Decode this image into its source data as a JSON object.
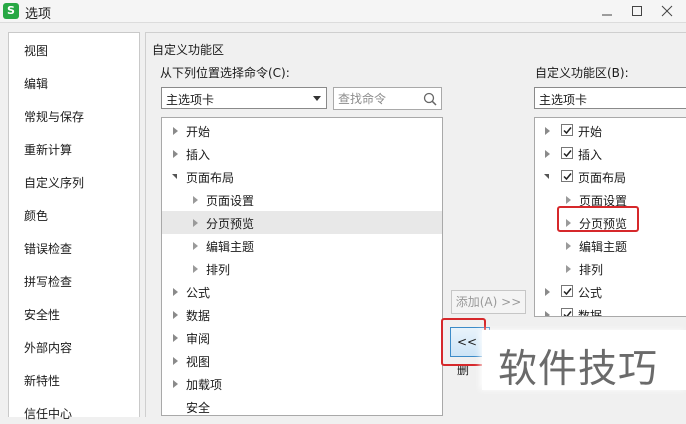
{
  "window": {
    "title": "选项",
    "app_icon_letter": "S",
    "accent_color": "#27a844"
  },
  "sidebar": {
    "items": [
      {
        "label": "视图"
      },
      {
        "label": "编辑"
      },
      {
        "label": "常规与保存"
      },
      {
        "label": "重新计算"
      },
      {
        "label": "自定义序列"
      },
      {
        "label": "颜色"
      },
      {
        "label": "错误检查"
      },
      {
        "label": "拼写检查"
      },
      {
        "label": "安全性"
      },
      {
        "label": "外部内容"
      },
      {
        "label": "新特性"
      },
      {
        "label": "信任中心"
      }
    ]
  },
  "group_title": "自定义功能区",
  "left": {
    "choose_label": "从下列位置选择命令(C):",
    "dropdown_value": "主选项卡",
    "search_placeholder": "查找命令",
    "tree": [
      {
        "label": "开始"
      },
      {
        "label": "插入"
      },
      {
        "label": "页面布局"
      },
      {
        "label": "页面设置"
      },
      {
        "label": "分页预览"
      },
      {
        "label": "编辑主题"
      },
      {
        "label": "排列"
      },
      {
        "label": "公式"
      },
      {
        "label": "数据"
      },
      {
        "label": "审阅"
      },
      {
        "label": "视图"
      },
      {
        "label": "加载项"
      },
      {
        "label": "安全"
      }
    ]
  },
  "right": {
    "customize_label": "自定义功能区(B):",
    "dropdown_value": "主选项卡",
    "tree": [
      {
        "label": "开始",
        "checked": true
      },
      {
        "label": "插入",
        "checked": true
      },
      {
        "label": "页面布局",
        "checked": true
      },
      {
        "label": "页面设置"
      },
      {
        "label": "分页预览"
      },
      {
        "label": "编辑主题"
      },
      {
        "label": "排列"
      },
      {
        "label": "公式",
        "checked": true
      },
      {
        "label": "数据",
        "checked": true
      }
    ]
  },
  "buttons": {
    "add_label": "添加(A) >>",
    "remove_label": "<< 删"
  },
  "watermark": "软件技巧",
  "highlight_color": "#d6282b"
}
